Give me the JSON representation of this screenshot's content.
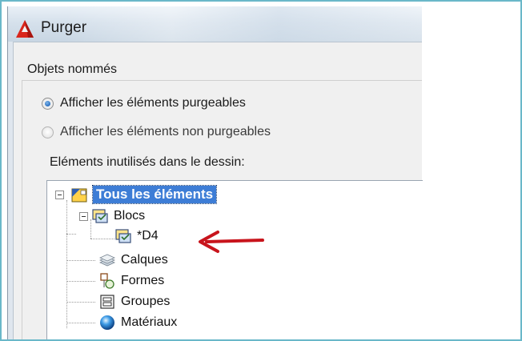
{
  "window": {
    "title": "Purger"
  },
  "section": {
    "label": "Objets nommés"
  },
  "radios": [
    {
      "label": "Afficher les éléments purgeables",
      "checked": true
    },
    {
      "label": "Afficher les éléments non purgeables",
      "checked": false
    }
  ],
  "tree_heading": "Eléments inutilisés dans le dessin:",
  "tree": {
    "root": {
      "label": "Tous les éléments",
      "icon": "all-items-icon",
      "selected": true
    },
    "blocs": {
      "label": "Blocs",
      "icon": "block-icon"
    },
    "d4": {
      "label": "*D4",
      "icon": "block-icon"
    },
    "calques": {
      "label": "Calques",
      "icon": "layers-icon"
    },
    "formes": {
      "label": "Formes",
      "icon": "shapes-icon"
    },
    "groupes": {
      "label": "Groupes",
      "icon": "groups-icon"
    },
    "materiaux": {
      "label": "Matériaux",
      "icon": "materials-icon"
    }
  },
  "colors": {
    "selection": "#3d7dd6",
    "arrow": "#c8141c",
    "frame_border": "#6ab8c9"
  }
}
